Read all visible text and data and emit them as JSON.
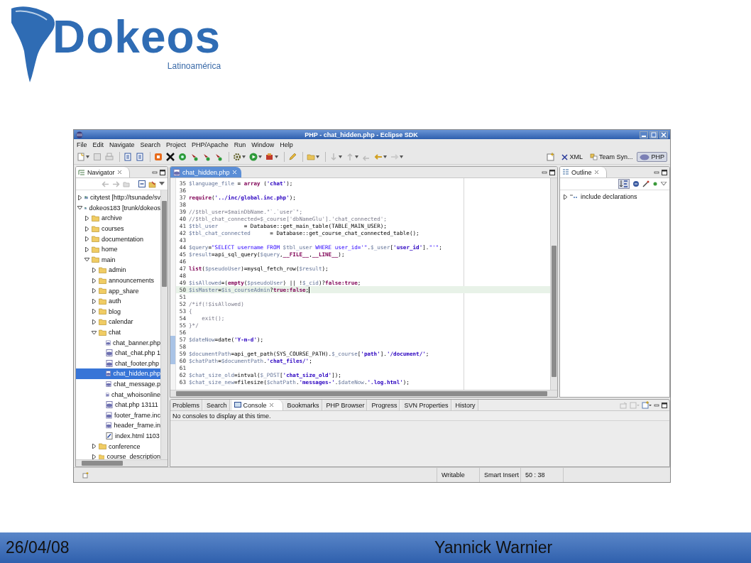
{
  "slide": {
    "logo": {
      "wordmark": "Dokeos",
      "tagline": "Latinoamérica"
    },
    "footer": {
      "date": "26/04/08",
      "author": "Yannick Warnier"
    }
  },
  "window": {
    "title": "PHP - chat_hidden.php - Eclipse SDK",
    "menu": [
      "File",
      "Edit",
      "Navigate",
      "Search",
      "Project",
      "PHP/Apache",
      "Run",
      "Window",
      "Help"
    ],
    "perspectives": [
      {
        "label": "XML",
        "selected": false
      },
      {
        "label": "Team Syn...",
        "selected": false
      },
      {
        "label": "PHP",
        "selected": true
      }
    ]
  },
  "navigator": {
    "title": "Navigator",
    "tree": [
      {
        "label": "citytest [http://tsunade/sv",
        "kind": "project",
        "expanded": false,
        "selected": false
      },
      {
        "label": "dokeos183 [trunk/dokeos",
        "kind": "project",
        "expanded": true,
        "selected": false,
        "children": [
          {
            "label": "archive",
            "kind": "folder",
            "expanded": false,
            "selected": false
          },
          {
            "label": "courses",
            "kind": "folder",
            "expanded": false,
            "selected": false
          },
          {
            "label": "documentation",
            "kind": "folder",
            "expanded": false,
            "selected": false
          },
          {
            "label": "home",
            "kind": "folder",
            "expanded": false,
            "selected": false
          },
          {
            "label": "main",
            "kind": "folder",
            "expanded": true,
            "selected": false,
            "children": [
              {
                "label": "admin",
                "kind": "folder",
                "expanded": false,
                "selected": false
              },
              {
                "label": "announcements",
                "kind": "folder",
                "expanded": false,
                "selected": false
              },
              {
                "label": "app_share",
                "kind": "folder",
                "expanded": false,
                "selected": false
              },
              {
                "label": "auth",
                "kind": "folder",
                "expanded": false,
                "selected": false
              },
              {
                "label": "blog",
                "kind": "folder",
                "expanded": false,
                "selected": false
              },
              {
                "label": "calendar",
                "kind": "folder",
                "expanded": false,
                "selected": false
              },
              {
                "label": "chat",
                "kind": "folder",
                "expanded": true,
                "selected": false,
                "children": [
                  {
                    "label": "chat_banner.php",
                    "kind": "php",
                    "selected": false
                  },
                  {
                    "label": "chat_chat.php 1",
                    "kind": "php",
                    "selected": false
                  },
                  {
                    "label": "chat_footer.php",
                    "kind": "php",
                    "selected": false
                  },
                  {
                    "label": "chat_hidden.php",
                    "kind": "php",
                    "selected": true
                  },
                  {
                    "label": "chat_message.p",
                    "kind": "php",
                    "selected": false
                  },
                  {
                    "label": "chat_whoisonline",
                    "kind": "php",
                    "selected": false
                  },
                  {
                    "label": "chat.php 13111",
                    "kind": "php",
                    "selected": false
                  },
                  {
                    "label": "footer_frame.inc",
                    "kind": "php",
                    "selected": false
                  },
                  {
                    "label": "header_frame.in",
                    "kind": "php",
                    "selected": false
                  },
                  {
                    "label": "index.html 1103",
                    "kind": "html",
                    "selected": false
                  }
                ]
              },
              {
                "label": "conference",
                "kind": "folder",
                "expanded": false,
                "selected": false
              },
              {
                "label": "course_description",
                "kind": "folder",
                "expanded": false,
                "selected": false
              }
            ]
          }
        ]
      }
    ]
  },
  "editor": {
    "tabs": [
      {
        "label": "chat_hidden.php",
        "selected": true
      }
    ],
    "lines": [
      {
        "number": "35",
        "current": false,
        "changed": false,
        "segments": [
          {
            "kind": "var",
            "text": "$language_file"
          },
          {
            "kind": "plain",
            "text": " = "
          },
          {
            "kind": "keyword",
            "text": "array"
          },
          {
            "kind": "plain",
            "text": " ("
          },
          {
            "kind": "string",
            "text": "'chat'"
          },
          {
            "kind": "plain",
            "text": ");"
          }
        ]
      },
      {
        "number": "36",
        "current": false,
        "changed": false
      },
      {
        "number": "37",
        "current": false,
        "changed": false,
        "segments": [
          {
            "kind": "keyword",
            "text": "require"
          },
          {
            "kind": "plain",
            "text": "("
          },
          {
            "kind": "string",
            "text": "'../inc/global.inc.php'"
          },
          {
            "kind": "plain",
            "text": ");"
          }
        ]
      },
      {
        "number": "38",
        "current": false,
        "changed": false
      },
      {
        "number": "39",
        "current": false,
        "changed": false,
        "segments": [
          {
            "kind": "comment",
            "text": "//$tbl_user=$mainDbName.\"`.`user`\";"
          }
        ]
      },
      {
        "number": "40",
        "current": false,
        "changed": false,
        "segments": [
          {
            "kind": "comment",
            "text": "//$tbl_chat_connected=$_course['dbNameGlu'].'chat_connected';"
          }
        ]
      },
      {
        "number": "41",
        "current": false,
        "changed": false,
        "segments": [
          {
            "kind": "var",
            "text": "$tbl_user"
          },
          {
            "kind": "plain",
            "text": "        = Database::get_main_table(TABLE_MAIN_USER);"
          }
        ]
      },
      {
        "number": "42",
        "current": false,
        "changed": false,
        "segments": [
          {
            "kind": "var",
            "text": "$tbl_chat_connected"
          },
          {
            "kind": "plain",
            "text": "      = Database::get_course_chat_connected_table();"
          }
        ]
      },
      {
        "number": "43",
        "current": false,
        "changed": false
      },
      {
        "number": "44",
        "current": false,
        "changed": false,
        "segments": [
          {
            "kind": "var",
            "text": "$query"
          },
          {
            "kind": "plain",
            "text": "="
          },
          {
            "kind": "dstring",
            "text": "\"SELECT username FROM "
          },
          {
            "kind": "var",
            "text": "$tbl_user"
          },
          {
            "kind": "dstring",
            "text": " WHERE user_id='\""
          },
          {
            "kind": "plain",
            "text": "."
          },
          {
            "kind": "var",
            "text": "$_user"
          },
          {
            "kind": "plain",
            "text": "["
          },
          {
            "kind": "string",
            "text": "'user_id'"
          },
          {
            "kind": "plain",
            "text": "]."
          },
          {
            "kind": "dstring",
            "text": "\"'\""
          },
          {
            "kind": "plain",
            "text": ";"
          }
        ]
      },
      {
        "number": "45",
        "current": false,
        "changed": false,
        "segments": [
          {
            "kind": "var",
            "text": "$result"
          },
          {
            "kind": "plain",
            "text": "=api_sql_query("
          },
          {
            "kind": "var",
            "text": "$query"
          },
          {
            "kind": "plain",
            "text": ","
          },
          {
            "kind": "constant",
            "text": "__FILE__"
          },
          {
            "kind": "plain",
            "text": ","
          },
          {
            "kind": "constant",
            "text": "__LINE__"
          },
          {
            "kind": "plain",
            "text": ");"
          }
        ]
      },
      {
        "number": "46",
        "current": false,
        "changed": false
      },
      {
        "number": "47",
        "current": false,
        "changed": false,
        "segments": [
          {
            "kind": "keyword",
            "text": "list"
          },
          {
            "kind": "plain",
            "text": "("
          },
          {
            "kind": "var",
            "text": "$pseudoUser"
          },
          {
            "kind": "plain",
            "text": ")=mysql_fetch_row("
          },
          {
            "kind": "var",
            "text": "$result"
          },
          {
            "kind": "plain",
            "text": ");"
          }
        ]
      },
      {
        "number": "48",
        "current": false,
        "changed": false
      },
      {
        "number": "49",
        "current": false,
        "changed": false,
        "segments": [
          {
            "kind": "var",
            "text": "$isAllowed"
          },
          {
            "kind": "plain",
            "text": "=("
          },
          {
            "kind": "keyword",
            "text": "empty"
          },
          {
            "kind": "plain",
            "text": "("
          },
          {
            "kind": "var",
            "text": "$pseudoUser"
          },
          {
            "kind": "plain",
            "text": ") || !"
          },
          {
            "kind": "var",
            "text": "$_cid"
          },
          {
            "kind": "plain",
            "text": ")?"
          },
          {
            "kind": "keyword",
            "text": "false:true"
          },
          {
            "kind": "plain",
            "text": ";"
          }
        ]
      },
      {
        "number": "50",
        "current": true,
        "changed": false,
        "segments": [
          {
            "kind": "var",
            "text": "$isMaster"
          },
          {
            "kind": "plain",
            "text": "="
          },
          {
            "kind": "var",
            "text": "$is_courseAdmin"
          },
          {
            "kind": "plain",
            "text": "?"
          },
          {
            "kind": "keyword",
            "text": "true:false"
          },
          {
            "kind": "plain",
            "text": ";"
          }
        ]
      },
      {
        "number": "51",
        "current": false,
        "changed": false
      },
      {
        "number": "52",
        "current": false,
        "changed": false,
        "segments": [
          {
            "kind": "comment",
            "text": "/*if(!$isAllowed)"
          }
        ]
      },
      {
        "number": "53",
        "current": false,
        "changed": false,
        "segments": [
          {
            "kind": "comment",
            "text": "{"
          }
        ]
      },
      {
        "number": "54",
        "current": false,
        "changed": false,
        "segments": [
          {
            "kind": "comment",
            "text": "    exit();"
          }
        ]
      },
      {
        "number": "55",
        "current": false,
        "changed": false,
        "segments": [
          {
            "kind": "comment",
            "text": "}*/"
          }
        ]
      },
      {
        "number": "56",
        "current": false,
        "changed": false
      },
      {
        "number": "57",
        "current": false,
        "changed": true,
        "segments": [
          {
            "kind": "var",
            "text": "$dateNow"
          },
          {
            "kind": "plain",
            "text": "=date("
          },
          {
            "kind": "string",
            "text": "'Y-m-d'"
          },
          {
            "kind": "plain",
            "text": ");"
          }
        ]
      },
      {
        "number": "58",
        "current": false,
        "changed": true
      },
      {
        "number": "59",
        "current": false,
        "changed": true,
        "segments": [
          {
            "kind": "var",
            "text": "$documentPath"
          },
          {
            "kind": "plain",
            "text": "=api_get_path(SYS_COURSE_PATH)."
          },
          {
            "kind": "var",
            "text": "$_course"
          },
          {
            "kind": "plain",
            "text": "["
          },
          {
            "kind": "string",
            "text": "'path'"
          },
          {
            "kind": "plain",
            "text": "]."
          },
          {
            "kind": "string",
            "text": "'/document/'"
          },
          {
            "kind": "plain",
            "text": ";"
          }
        ]
      },
      {
        "number": "60",
        "current": false,
        "changed": true,
        "segments": [
          {
            "kind": "var",
            "text": "$chatPath"
          },
          {
            "kind": "plain",
            "text": "="
          },
          {
            "kind": "var",
            "text": "$documentPath"
          },
          {
            "kind": "plain",
            "text": "."
          },
          {
            "kind": "string",
            "text": "'chat_files/'"
          },
          {
            "kind": "plain",
            "text": ";"
          }
        ]
      },
      {
        "number": "61",
        "current": false,
        "changed": false
      },
      {
        "number": "62",
        "current": false,
        "changed": false,
        "segments": [
          {
            "kind": "var",
            "text": "$chat_size_old"
          },
          {
            "kind": "plain",
            "text": "=intval("
          },
          {
            "kind": "var",
            "text": "$_POST"
          },
          {
            "kind": "plain",
            "text": "["
          },
          {
            "kind": "string",
            "text": "'chat_size_old'"
          },
          {
            "kind": "plain",
            "text": "]);"
          }
        ]
      },
      {
        "number": "63",
        "current": false,
        "changed": false,
        "segments": [
          {
            "kind": "var",
            "text": "$chat_size_new"
          },
          {
            "kind": "plain",
            "text": "=filesize("
          },
          {
            "kind": "var",
            "text": "$chatPath"
          },
          {
            "kind": "plain",
            "text": "."
          },
          {
            "kind": "string",
            "text": "'messages-'"
          },
          {
            "kind": "plain",
            "text": "."
          },
          {
            "kind": "var",
            "text": "$dateNow"
          },
          {
            "kind": "plain",
            "text": "."
          },
          {
            "kind": "string",
            "text": "'.log.html'"
          },
          {
            "kind": "plain",
            "text": ");"
          }
        ]
      }
    ]
  },
  "outline": {
    "title": "Outline",
    "items": [
      {
        "label": "include declarations",
        "expanded": false
      }
    ]
  },
  "console": {
    "tabs": [
      {
        "label": "Problems",
        "selected": false
      },
      {
        "label": "Search",
        "selected": false
      },
      {
        "label": "Console",
        "selected": true
      },
      {
        "label": "Bookmarks",
        "selected": false
      },
      {
        "label": "PHP Browser",
        "selected": false
      },
      {
        "label": "Progress",
        "selected": false
      },
      {
        "label": "SVN Properties",
        "selected": false
      },
      {
        "label": "History",
        "selected": false
      }
    ],
    "message": "No consoles to display at this time."
  },
  "status_bar": {
    "mode": "Writable",
    "insert": "Smart Insert",
    "position": "50 : 38"
  }
}
